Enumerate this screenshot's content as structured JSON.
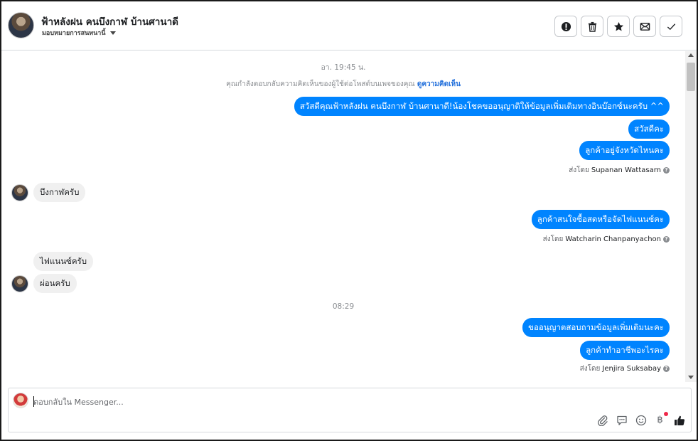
{
  "header": {
    "title": "ฟ้าหลังฝน คนบึงกาฬ บ้านศานาดี",
    "assign_label": "มอบหมายการสนทนานี้",
    "actions": [
      {
        "name": "mark-spam-icon"
      },
      {
        "name": "delete-icon"
      },
      {
        "name": "star-icon"
      },
      {
        "name": "mark-unread-icon"
      },
      {
        "name": "mark-done-icon"
      }
    ]
  },
  "thread": {
    "timestamp1": "อา. 19:45 น.",
    "notice_text": "คุณกำลังตอบกลับความคิดเห็นของผู้ใช้ต่อโพสต์บนเพจของคุณ",
    "notice_link": "ดูความคิดเห็น",
    "messages": [
      {
        "dir": "out",
        "text": "สวัสดีคุณฟ้าหลังฝน คนบึงกาฬ บ้านศานาดี!น้องโชคขออนุญาติให้ข้อมูลเพิ่มเติมทางอินบ๊อกซ์นะครับ ^^"
      },
      {
        "dir": "out",
        "text": "สวัสดีคะ"
      },
      {
        "dir": "out",
        "text": "ลูกค้าอยู่จังหวัดไหนคะ"
      },
      {
        "dir": "in",
        "text": "บึงกาฬครับ"
      },
      {
        "dir": "out",
        "text": "ลูกค้าสนใจซื้อสดหรือจัดไฟแนนซ์คะ"
      },
      {
        "dir": "in",
        "text": "ไฟแนนซ์ครับ"
      },
      {
        "dir": "in",
        "text": "ผ่อนครับ"
      },
      {
        "dir": "out",
        "text": "ขออนุญาตสอบถามข้อมูลเพิ่มเติมนะคะ"
      },
      {
        "dir": "out",
        "text": "ลูกค้าทำอาชีพอะไรคะ"
      }
    ],
    "sent_by_prefix": "ส่งโดย",
    "sent_by": [
      "Supanan Wattasarn",
      "Watcharin Chanpanyachon",
      "Jenjira Suksabay"
    ],
    "timestamp2": "08:29"
  },
  "composer": {
    "placeholder": "ตอบกลับใน Messenger...",
    "value": "",
    "tools": [
      "attach-icon",
      "saved-reply-icon",
      "emoji-icon",
      "payment-icon",
      "like-icon"
    ],
    "payment_symbol": "฿"
  },
  "colors": {
    "outgoing_bubble": "#0084ff",
    "incoming_bubble": "#f0f0f0",
    "link": "#216fdb",
    "notification_dot": "#f02849"
  }
}
